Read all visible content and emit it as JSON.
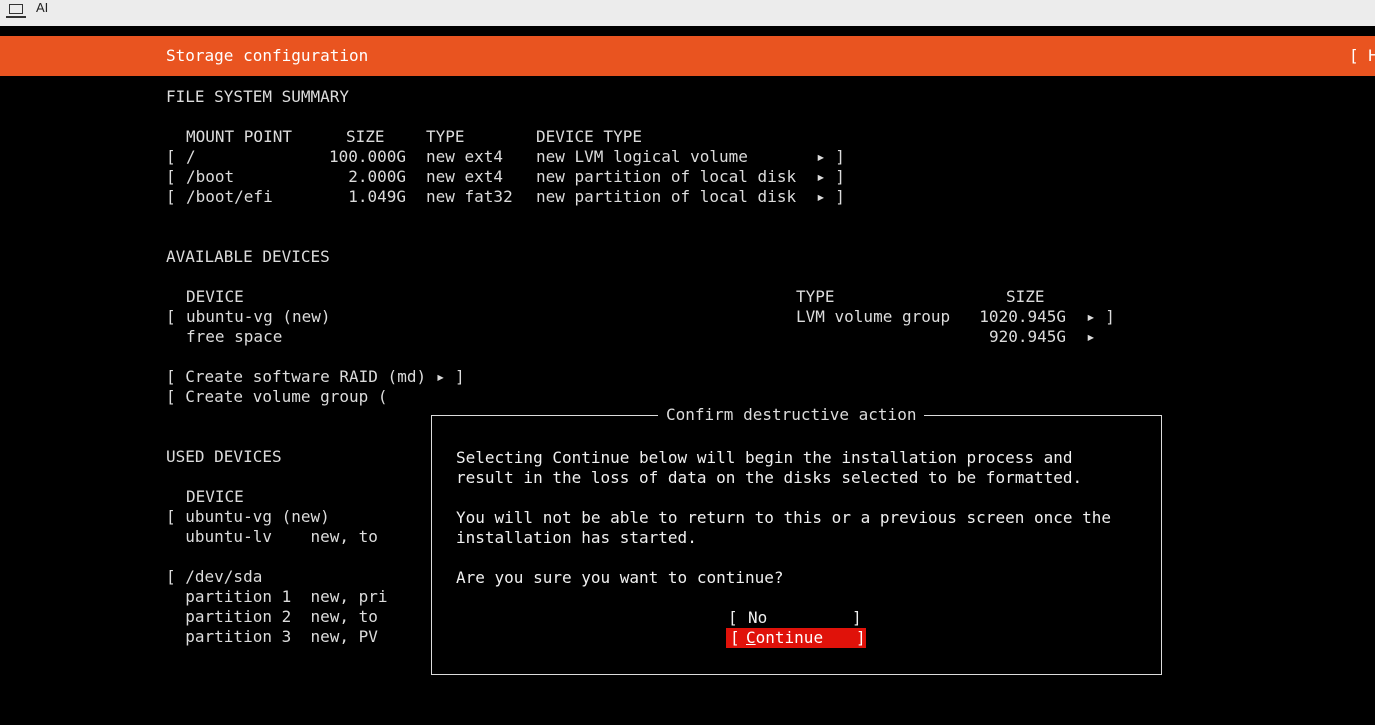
{
  "window": {
    "title": "AI"
  },
  "header": {
    "title": "Storage configuration",
    "help": "[ H"
  },
  "fs_summary": {
    "heading": "FILE SYSTEM SUMMARY",
    "columns": {
      "mount": "MOUNT POINT",
      "size": "SIZE",
      "type": "TYPE",
      "device_type": "DEVICE TYPE"
    },
    "rows": [
      {
        "open": "[",
        "mount": "/",
        "size": "100.000G",
        "type": "new ext4",
        "device_type": "new LVM logical volume",
        "arrow": "▸ ]"
      },
      {
        "open": "[",
        "mount": "/boot",
        "size": "2.000G",
        "type": "new ext4",
        "device_type": "new partition of local disk",
        "arrow": "▸ ]"
      },
      {
        "open": "[",
        "mount": "/boot/efi",
        "size": "1.049G",
        "type": "new fat32",
        "device_type": "new partition of local disk",
        "arrow": "▸ ]"
      }
    ]
  },
  "available": {
    "heading": "AVAILABLE DEVICES",
    "columns": {
      "device": "DEVICE",
      "type": "TYPE",
      "size": "SIZE"
    },
    "rows": [
      {
        "open": "[",
        "device": "ubuntu-vg (new)",
        "type": "LVM volume group",
        "size": "1020.945G",
        "arrow": "▸ ]"
      },
      {
        "open": "",
        "device": "free space",
        "type": "",
        "size": "920.945G",
        "arrow": "▸"
      }
    ],
    "actions": [
      "[ Create software RAID (md) ▸ ]",
      "[ Create volume group ("
    ]
  },
  "used": {
    "heading": "USED DEVICES",
    "column_device": "DEVICE",
    "lines": [
      "[ ubuntu-vg (new)",
      "  ubuntu-lv    new, to",
      "",
      "[ /dev/sda",
      "  partition 1  new, pri",
      "  partition 2  new, to",
      "  partition 3  new, PV"
    ]
  },
  "dialog": {
    "title": "Confirm destructive action",
    "line1": "Selecting Continue below will begin the installation process and",
    "line2": "result in the loss of data on the disks selected to be formatted.",
    "line3": "You will not be able to return to this or a previous screen once the",
    "line4": "installation has started.",
    "line5": "Are you sure you want to continue?",
    "no_label": "No",
    "continue_first": "C",
    "continue_rest": "ontinue",
    "bracket_open": "[",
    "bracket_close": "]"
  },
  "colors": {
    "accent": "#e95420",
    "selected": "#e0120a"
  }
}
